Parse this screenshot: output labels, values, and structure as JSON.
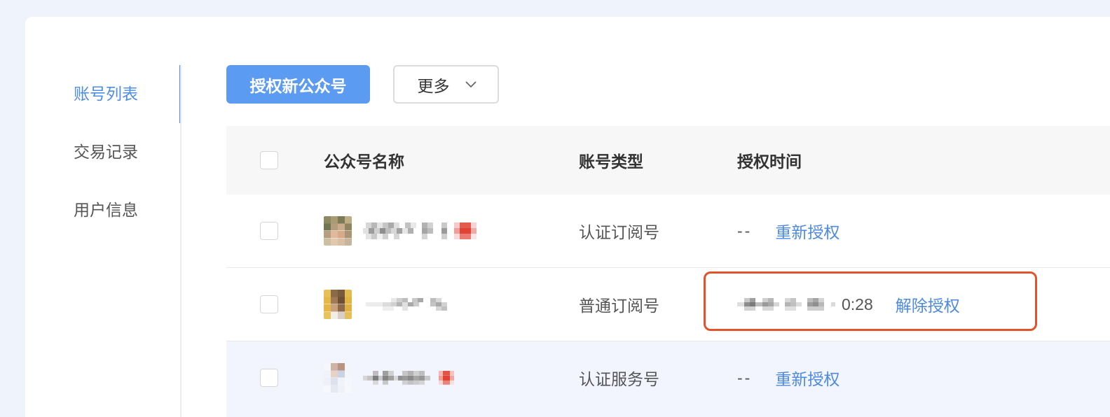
{
  "sidebar": {
    "items": [
      {
        "label": "账号列表",
        "active": true
      },
      {
        "label": "交易记录",
        "active": false
      },
      {
        "label": "用户信息",
        "active": false
      }
    ]
  },
  "toolbar": {
    "authorize_button": "授权新公众号",
    "more_button": "更多",
    "more_icon": "chevron-down-icon"
  },
  "table": {
    "select_all_checked": false,
    "columns": {
      "name": "公众号名称",
      "type": "账号类型",
      "auth_time": "授权时间"
    },
    "rows": [
      {
        "checked": false,
        "avatar_icon": "account-avatar",
        "type": "认证订阅号",
        "auth_time": "--",
        "action": "重新授权",
        "hovered": false
      },
      {
        "checked": false,
        "avatar_icon": "account-avatar",
        "type": "普通订阅号",
        "auth_time": "0:28",
        "action": "解除授权",
        "hovered": false
      },
      {
        "checked": false,
        "avatar_icon": "account-avatar",
        "type": "认证服务号",
        "auth_time": "--",
        "action": "重新授权",
        "hovered": true
      }
    ]
  },
  "colors": {
    "page_background": "#eff3fb",
    "primary": "#5b9bf1",
    "link": "#4d8ae0",
    "active_nav": "#4f8de2",
    "row_hover": "#f2f5fe",
    "highlight": "#e3532b"
  }
}
